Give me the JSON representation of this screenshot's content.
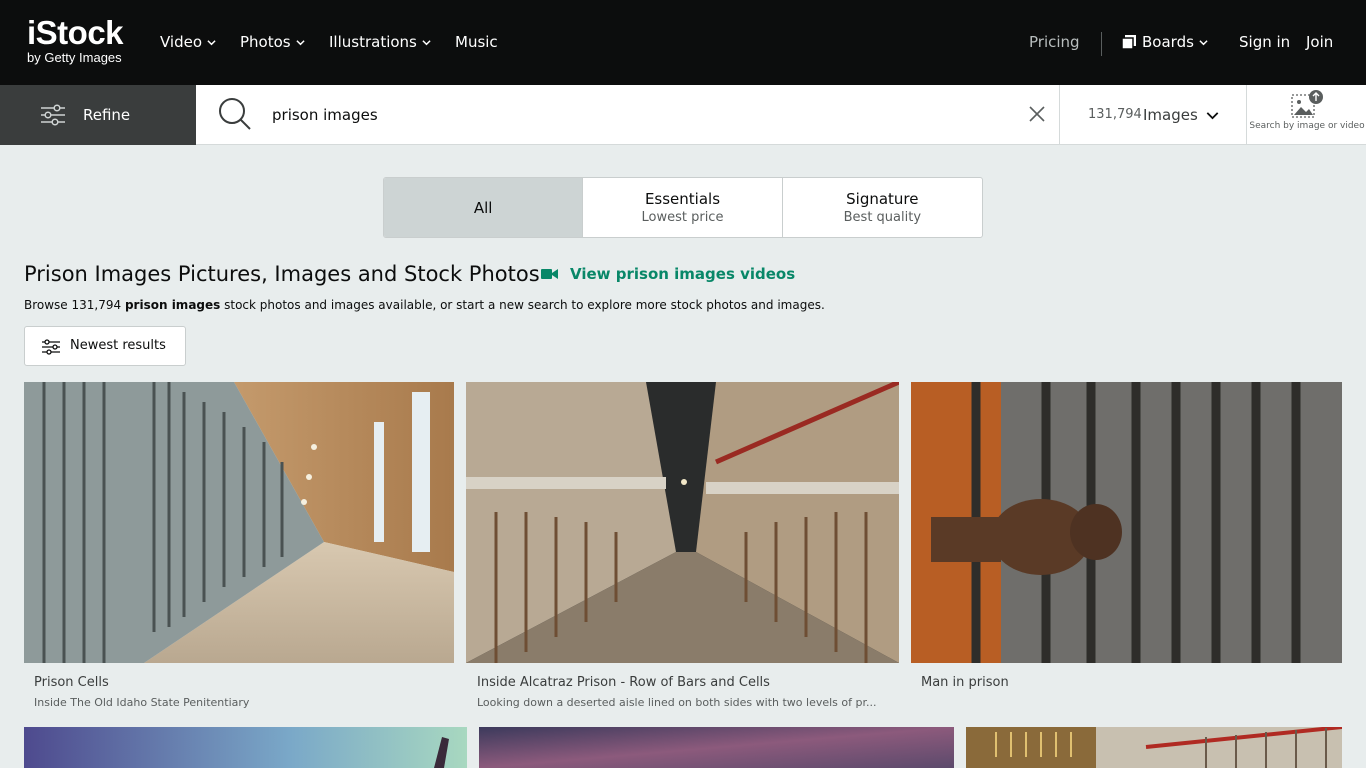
{
  "header": {
    "logo_main": "iStock",
    "logo_sub": "by Getty Images",
    "nav": [
      {
        "label": "Video"
      },
      {
        "label": "Photos"
      },
      {
        "label": "Illustrations"
      },
      {
        "label": "Music"
      }
    ],
    "pricing": "Pricing",
    "boards": "Boards",
    "sign_in": "Sign in",
    "join": "Join"
  },
  "search": {
    "refine_label": "Refine",
    "query": "prison images",
    "result_count": "131,794",
    "media_type": "Images",
    "by_image_label": "Search by image or video"
  },
  "tabs": [
    {
      "title": "All",
      "subtitle": ""
    },
    {
      "title": "Essentials",
      "subtitle": "Lowest price"
    },
    {
      "title": "Signature",
      "subtitle": "Best quality"
    }
  ],
  "results": {
    "title": "Prison Images Pictures, Images and Stock Photos",
    "videos_link": "View prison images videos",
    "browse_prefix": "Browse 131,794",
    "browse_bold": "prison images",
    "browse_suffix": "stock photos and images available, or start a new search to explore more stock photos and images.",
    "sort_label": "Newest results"
  },
  "images": [
    {
      "title": "Prison Cells",
      "subtitle": "Inside The Old Idaho State Penitentiary"
    },
    {
      "title": "Inside Alcatraz Prison - Row of Bars and Cells",
      "subtitle": "Looking down a deserted aisle lined on both sides with two levels of pr..."
    },
    {
      "title": "Man in prison",
      "subtitle": ""
    }
  ],
  "colors": {
    "header_bg": "#0c0d0d",
    "accent_green": "#088768",
    "page_bg": "#e8eded"
  }
}
